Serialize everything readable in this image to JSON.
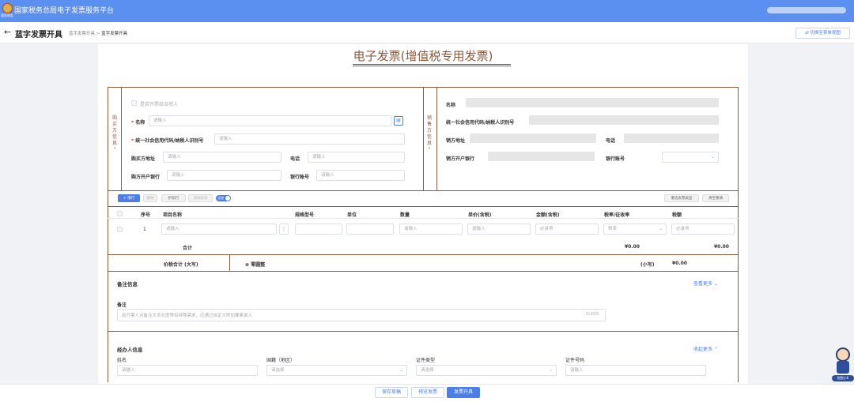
{
  "topbar": {
    "title": "国家税务总局电子发票服务平台",
    "emblem_label": "国家税务"
  },
  "subheader": {
    "back_icon": "arrow-left-icon",
    "title": "蓝字发票开具",
    "breadcrumb": [
      "蓝字发票开具",
      "蓝字发票开具"
    ],
    "switch_label": "切换至表单视图"
  },
  "invoice": {
    "title": "电子发票(增值税专用发票)",
    "buyer_label": "购\n买\n方\n信\n息\n⌃",
    "seller_label": "销\n售\n方\n信\n息\n⌃",
    "natural_person": "是否开票给自然人",
    "buyer": {
      "name_label": "名称",
      "name_placeholder": "请输入",
      "taxid_label": "统一社会信用代码/纳税人识别号",
      "taxid_placeholder": "请输入",
      "address_label": "购买方地址",
      "address_placeholder": "请输入",
      "phone_label": "电话",
      "phone_placeholder": "请输入",
      "bank_label": "购方开户银行",
      "bank_placeholder": "请输入",
      "account_label": "银行账号",
      "account_placeholder": "请输入"
    },
    "seller": {
      "name_label": "名称",
      "taxid_label": "统一社会信用代码/纳税人识别号",
      "address_label": "销方地址",
      "phone_label": "电话",
      "bank_label": "销方开户银行",
      "account_label": "银行账号"
    }
  },
  "toolbar": {
    "add": "+ 增行",
    "delete": "删除",
    "discount": "折扣行",
    "add_discount": "添加折扣",
    "tax_incl": "含税",
    "select_type": "重选发票类型",
    "clear": "清空重填"
  },
  "table": {
    "headers": [
      "序号",
      "项目名称",
      "规格型号",
      "单位",
      "数量",
      "单价(含税)",
      "金额(含税)",
      "税率/征收率",
      "税额"
    ],
    "row": {
      "index": "1",
      "name_ph": "请输入",
      "qty_ph": "请输入",
      "price_ph": "请输入",
      "amount_ph": "必录项",
      "rate_ph": "税率",
      "tax_ph": "必录项"
    },
    "total_label": "合计",
    "total_amount": "¥0.00",
    "total_tax": "¥0.00",
    "sum_label": "价税合计 (大写)",
    "sum_upper": "⊗ 零圆整",
    "small_label": "(小写)",
    "small_value": "¥0.00"
  },
  "remarks": {
    "section": "备注信息",
    "more": "查看更多 ⌄",
    "label": "备注",
    "placeholder": "如开票人对备注文本长度等有特殊需求，应通过自定义附加要素录入",
    "count": "0/200"
  },
  "handler": {
    "section": "经办人信息",
    "collapse": "收起更多 ⌃",
    "name_label": "姓名",
    "name_ph": "请输入",
    "country_label": "国籍（地区）",
    "country_ph": "请选择",
    "id_type_label": "证件类型",
    "id_type_ph": "请选择",
    "id_no_label": "证件号码",
    "id_no_ph": "请输入"
  },
  "footer": {
    "save": "保存草稿",
    "preview": "预览发票",
    "issue": "发票开具"
  },
  "mascot": {
    "badge": "税税小E"
  },
  "colors": {
    "topbar": "#5b8ff0",
    "brown": "#8b5a3c",
    "primary": "#4a7ee8"
  }
}
